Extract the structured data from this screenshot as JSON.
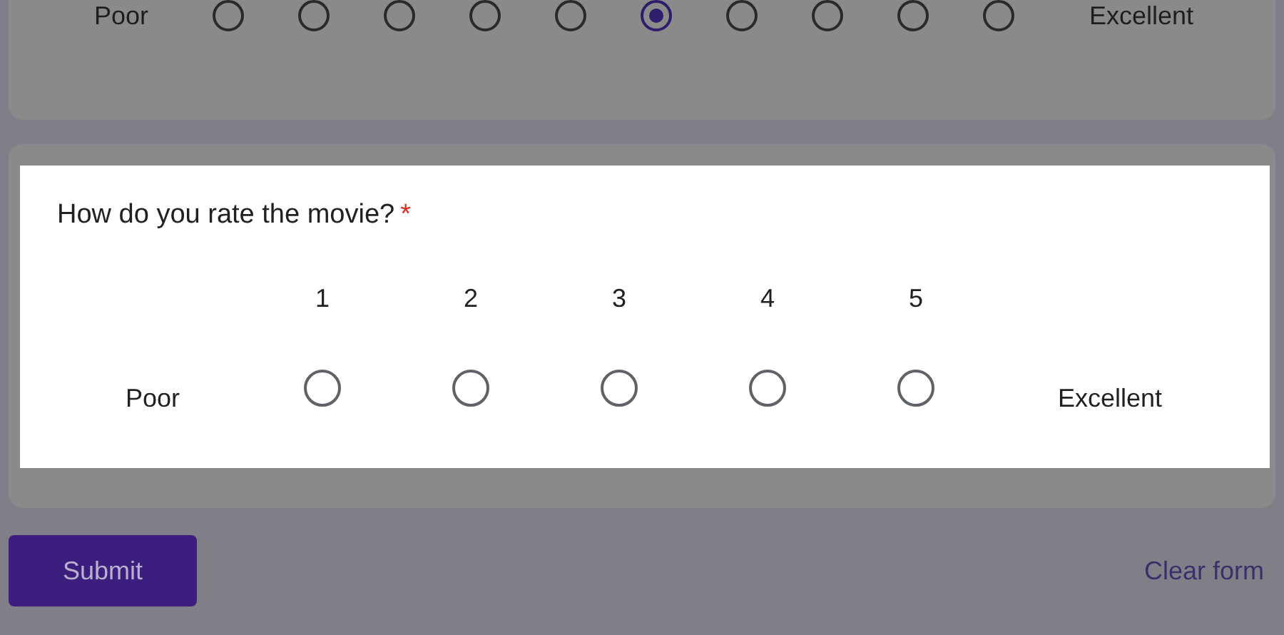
{
  "scales": [
    {
      "highlighted": false,
      "low_label": "Poor",
      "high_label": "Excellent",
      "options": [
        {
          "selected": false
        },
        {
          "selected": false
        },
        {
          "selected": false
        },
        {
          "selected": false
        },
        {
          "selected": false
        },
        {
          "selected": true
        },
        {
          "selected": false
        },
        {
          "selected": false
        },
        {
          "selected": false
        },
        {
          "selected": false
        }
      ]
    },
    {
      "highlighted": true,
      "question": "How do you rate the movie?",
      "required_mark": "*",
      "low_label": "Poor",
      "high_label": "Excellent",
      "options": [
        {
          "label": "1",
          "selected": false
        },
        {
          "label": "2",
          "selected": false
        },
        {
          "label": "3",
          "selected": false
        },
        {
          "label": "4",
          "selected": false
        },
        {
          "label": "5",
          "selected": false
        }
      ]
    }
  ],
  "submit": "Submit",
  "clear": "Clear form"
}
